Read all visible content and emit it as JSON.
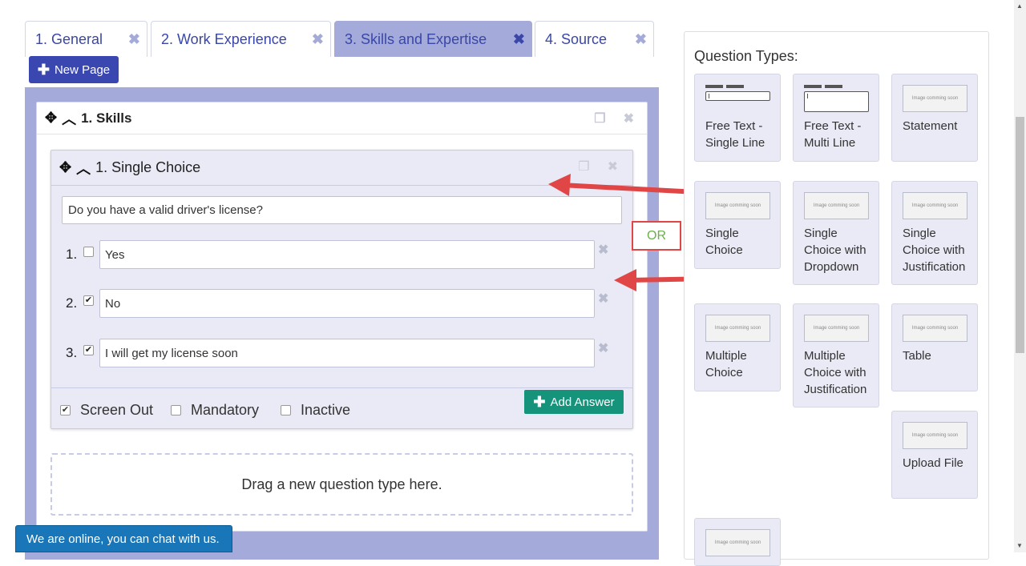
{
  "tabs": [
    {
      "label": "1. General"
    },
    {
      "label": "2. Work Experience"
    },
    {
      "label": "3. Skills and Expertise"
    },
    {
      "label": "4. Source"
    }
  ],
  "tab_close_glyph": "✖",
  "new_page_label": "New Page",
  "page": {
    "title": "1. Skills",
    "question": {
      "title": "1. Single Choice",
      "text": "Do you have a valid driver's license?",
      "answers": [
        {
          "number": "1.",
          "value": "Yes",
          "checked": false
        },
        {
          "number": "2.",
          "value": "No",
          "checked": true
        },
        {
          "number": "3.",
          "value": "I will get my license soon",
          "checked": true
        }
      ],
      "options": [
        {
          "label": "Screen Out",
          "checked": true
        },
        {
          "label": "Mandatory",
          "checked": false
        },
        {
          "label": "Inactive",
          "checked": false
        }
      ],
      "add_answer_label": "Add Answer"
    },
    "drop_zone_text": "Drag a new question type here."
  },
  "annotation": {
    "or_label": "OR",
    "color": "#e04646"
  },
  "question_types": {
    "title": "Question Types:",
    "placeholder_text": "Image comming soon",
    "items": [
      {
        "label": "Free Text - Single Line"
      },
      {
        "label": "Free Text - Multi Line"
      },
      {
        "label": "Statement"
      },
      {
        "label": "Single Choice"
      },
      {
        "label": "Single Choice with Dropdown"
      },
      {
        "label": "Single Choice with Justification"
      },
      {
        "label": "Multiple Choice"
      },
      {
        "label": "Multiple Choice with Justification"
      },
      {
        "label": "Table"
      },
      {
        "label": "Upload File"
      }
    ]
  },
  "chat": {
    "label": "We are online, you can chat with us."
  },
  "colors": {
    "accent": "#3a47b0",
    "tab_active": "#a4aad9",
    "success": "#16937b",
    "chat": "#1976b8"
  }
}
